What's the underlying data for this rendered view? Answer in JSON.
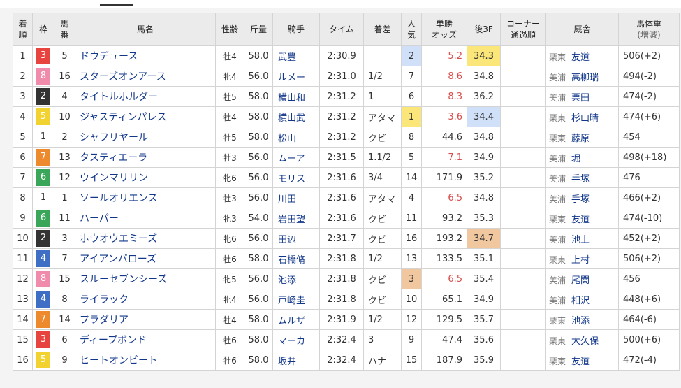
{
  "headers": {
    "rank": "着順",
    "frame": "枠",
    "num": "馬番",
    "horse": "馬名",
    "sexage": "性齢",
    "weight": "斤量",
    "jockey": "騎手",
    "time": "タイム",
    "margin": "着差",
    "pop": "人気",
    "odds": "単勝オッズ",
    "last3f": "後3F",
    "corner": "コーナー通過順",
    "trainer": "厩舎",
    "bodyweight": "馬体重(増減)"
  },
  "frame_colors": {
    "1": {
      "bg": "#ffffff",
      "fg": "#333333"
    },
    "2": {
      "bg": "#333333",
      "fg": "#ffffff"
    },
    "3": {
      "bg": "#e8443f",
      "fg": "#ffffff"
    },
    "4": {
      "bg": "#3f6fc4",
      "fg": "#ffffff"
    },
    "5": {
      "bg": "#f2d230",
      "fg": "#ffffff"
    },
    "6": {
      "bg": "#3aa65a",
      "fg": "#ffffff"
    },
    "7": {
      "bg": "#ee8a2e",
      "fg": "#ffffff"
    },
    "8": {
      "bg": "#f08bab",
      "fg": "#ffffff"
    }
  },
  "rows": [
    {
      "rank": "1",
      "frame": "3",
      "num": "5",
      "horse": "ドウデュース",
      "sexage": "牡4",
      "weight": "58.0",
      "jockey": "武豊",
      "time": "2:30.9",
      "margin": "",
      "pop": "2",
      "odds": "5.2",
      "last3f": "34.3",
      "corner": "",
      "region": "栗東",
      "trainer": "友道",
      "bodyweight": "506(+2)",
      "odds_hi": true,
      "pop_bg": "blue",
      "last3f_bg": "yellow"
    },
    {
      "rank": "2",
      "frame": "8",
      "num": "16",
      "horse": "スターズオンアース",
      "sexage": "牝4",
      "weight": "56.0",
      "jockey": "ルメー",
      "time": "2:31.0",
      "margin": "1/2",
      "pop": "7",
      "odds": "8.6",
      "last3f": "34.8",
      "corner": "",
      "region": "美浦",
      "trainer": "高柳瑞",
      "bodyweight": "494(-2)",
      "odds_hi": true,
      "pop_bg": "",
      "last3f_bg": ""
    },
    {
      "rank": "3",
      "frame": "2",
      "num": "4",
      "horse": "タイトルホルダー",
      "sexage": "牡5",
      "weight": "58.0",
      "jockey": "横山和",
      "time": "2:31.2",
      "margin": "1",
      "pop": "6",
      "odds": "8.3",
      "last3f": "36.2",
      "corner": "",
      "region": "美浦",
      "trainer": "栗田",
      "bodyweight": "474(-2)",
      "odds_hi": true,
      "pop_bg": "",
      "last3f_bg": ""
    },
    {
      "rank": "4",
      "frame": "5",
      "num": "10",
      "horse": "ジャスティンパレス",
      "sexage": "牡4",
      "weight": "58.0",
      "jockey": "横山武",
      "time": "2:31.2",
      "margin": "アタマ",
      "pop": "1",
      "odds": "3.6",
      "last3f": "34.4",
      "corner": "",
      "region": "栗東",
      "trainer": "杉山晴",
      "bodyweight": "474(+6)",
      "odds_hi": true,
      "pop_bg": "yellow",
      "last3f_bg": "blue"
    },
    {
      "rank": "5",
      "frame": "1",
      "num": "2",
      "horse": "シャフリヤール",
      "sexage": "牡5",
      "weight": "58.0",
      "jockey": "松山",
      "time": "2:31.2",
      "margin": "クビ",
      "pop": "8",
      "odds": "44.6",
      "last3f": "34.8",
      "corner": "",
      "region": "栗東",
      "trainer": "藤原",
      "bodyweight": "454",
      "odds_hi": false,
      "pop_bg": "",
      "last3f_bg": ""
    },
    {
      "rank": "6",
      "frame": "7",
      "num": "13",
      "horse": "タスティエーラ",
      "sexage": "牡3",
      "weight": "56.0",
      "jockey": "ムーア",
      "time": "2:31.5",
      "margin": "1.1/2",
      "pop": "5",
      "odds": "7.1",
      "last3f": "34.9",
      "corner": "",
      "region": "美浦",
      "trainer": "堀",
      "bodyweight": "498(+18)",
      "odds_hi": true,
      "pop_bg": "",
      "last3f_bg": ""
    },
    {
      "rank": "7",
      "frame": "6",
      "num": "12",
      "horse": "ウインマリリン",
      "sexage": "牝6",
      "weight": "56.0",
      "jockey": "モリス",
      "time": "2:31.6",
      "margin": "3/4",
      "pop": "14",
      "odds": "171.9",
      "last3f": "35.2",
      "corner": "",
      "region": "美浦",
      "trainer": "手塚",
      "bodyweight": "476",
      "odds_hi": false,
      "pop_bg": "",
      "last3f_bg": ""
    },
    {
      "rank": "8",
      "frame": "1",
      "num": "1",
      "horse": "ソールオリエンス",
      "sexage": "牡3",
      "weight": "56.0",
      "jockey": "川田",
      "time": "2:31.6",
      "margin": "アタマ",
      "pop": "4",
      "odds": "6.5",
      "last3f": "34.8",
      "corner": "",
      "region": "美浦",
      "trainer": "手塚",
      "bodyweight": "466(+2)",
      "odds_hi": true,
      "pop_bg": "",
      "last3f_bg": ""
    },
    {
      "rank": "9",
      "frame": "6",
      "num": "11",
      "horse": "ハーパー",
      "sexage": "牝3",
      "weight": "54.0",
      "jockey": "岩田望",
      "time": "2:31.6",
      "margin": "クビ",
      "pop": "11",
      "odds": "93.2",
      "last3f": "35.3",
      "corner": "",
      "region": "栗東",
      "trainer": "友道",
      "bodyweight": "474(-10)",
      "odds_hi": false,
      "pop_bg": "",
      "last3f_bg": ""
    },
    {
      "rank": "10",
      "frame": "2",
      "num": "3",
      "horse": "ホウオウエミーズ",
      "sexage": "牝6",
      "weight": "56.0",
      "jockey": "田辺",
      "time": "2:31.7",
      "margin": "クビ",
      "pop": "16",
      "odds": "193.2",
      "last3f": "34.7",
      "corner": "",
      "region": "美浦",
      "trainer": "池上",
      "bodyweight": "452(+2)",
      "odds_hi": false,
      "pop_bg": "",
      "last3f_bg": "orange"
    },
    {
      "rank": "11",
      "frame": "4",
      "num": "7",
      "horse": "アイアンバローズ",
      "sexage": "牡6",
      "weight": "58.0",
      "jockey": "石橋脩",
      "time": "2:31.8",
      "margin": "1/2",
      "pop": "13",
      "odds": "133.5",
      "last3f": "35.1",
      "corner": "",
      "region": "栗東",
      "trainer": "上村",
      "bodyweight": "506(+2)",
      "odds_hi": false,
      "pop_bg": "",
      "last3f_bg": ""
    },
    {
      "rank": "12",
      "frame": "8",
      "num": "15",
      "horse": "スルーセブンシーズ",
      "sexage": "牝5",
      "weight": "56.0",
      "jockey": "池添",
      "time": "2:31.8",
      "margin": "クビ",
      "pop": "3",
      "odds": "6.5",
      "last3f": "35.4",
      "corner": "",
      "region": "美浦",
      "trainer": "尾関",
      "bodyweight": "456",
      "odds_hi": true,
      "pop_bg": "orange",
      "last3f_bg": ""
    },
    {
      "rank": "13",
      "frame": "4",
      "num": "8",
      "horse": "ライラック",
      "sexage": "牝4",
      "weight": "56.0",
      "jockey": "戸崎圭",
      "time": "2:31.8",
      "margin": "クビ",
      "pop": "10",
      "odds": "65.1",
      "last3f": "34.9",
      "corner": "",
      "region": "美浦",
      "trainer": "相沢",
      "bodyweight": "448(+6)",
      "odds_hi": false,
      "pop_bg": "",
      "last3f_bg": ""
    },
    {
      "rank": "14",
      "frame": "7",
      "num": "14",
      "horse": "プラダリア",
      "sexage": "牡4",
      "weight": "58.0",
      "jockey": "ムルザ",
      "time": "2:31.9",
      "margin": "1/2",
      "pop": "12",
      "odds": "129.5",
      "last3f": "35.7",
      "corner": "",
      "region": "栗東",
      "trainer": "池添",
      "bodyweight": "464(-6)",
      "odds_hi": false,
      "pop_bg": "",
      "last3f_bg": ""
    },
    {
      "rank": "15",
      "frame": "3",
      "num": "6",
      "horse": "ディープボンド",
      "sexage": "牡6",
      "weight": "58.0",
      "jockey": "マーカ",
      "time": "2:32.4",
      "margin": "3",
      "pop": "9",
      "odds": "47.4",
      "last3f": "35.6",
      "corner": "",
      "region": "栗東",
      "trainer": "大久保",
      "bodyweight": "500(+6)",
      "odds_hi": false,
      "pop_bg": "",
      "last3f_bg": ""
    },
    {
      "rank": "16",
      "frame": "5",
      "num": "9",
      "horse": "ヒートオンビート",
      "sexage": "牡6",
      "weight": "58.0",
      "jockey": "坂井",
      "time": "2:32.4",
      "margin": "ハナ",
      "pop": "15",
      "odds": "187.9",
      "last3f": "35.9",
      "corner": "",
      "region": "栗東",
      "trainer": "友道",
      "bodyweight": "472(-4)",
      "odds_hi": false,
      "pop_bg": "",
      "last3f_bg": ""
    }
  ]
}
